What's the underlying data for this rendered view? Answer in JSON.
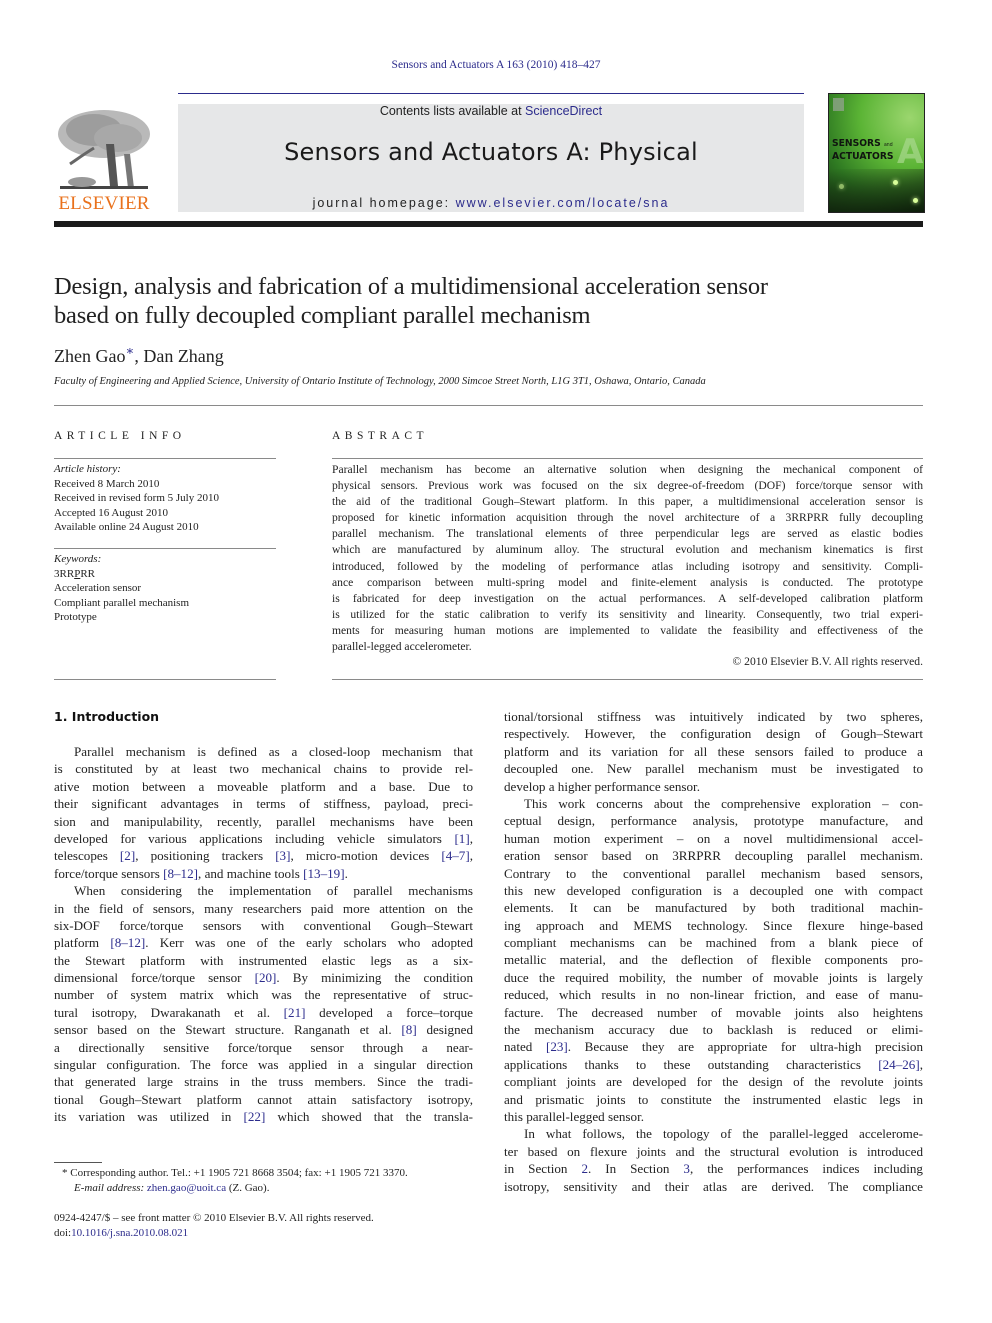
{
  "header": {
    "running_head": "Sensors and Actuators A 163 (2010) 418–427",
    "contents_prefix": "Contents lists available at ",
    "contents_link": "ScienceDirect",
    "journal_title": "Sensors and Actuators A: Physical",
    "homepage_prefix": "journal homepage: ",
    "homepage_link": "www.elsevier.com/locate/sna",
    "publisher_logo_text": "ELSEVIER",
    "cover": {
      "line1": "SENSORS",
      "and": "and",
      "line2": "ACTUATORS",
      "letter": "A"
    },
    "colors": {
      "link": "#2c2c8c",
      "publisher_orange": "#e9711c",
      "masthead_bg": "#e6e7e8",
      "cover_green": "#5bb435"
    }
  },
  "article": {
    "title_lines": [
      "Design, analysis and fabrication of a multidimensional acceleration sensor",
      "based on fully decoupled compliant parallel mechanism"
    ],
    "author1": "Zhen Gao",
    "author1_mark": "∗",
    "author_sep": ", ",
    "author2": "Dan Zhang",
    "affiliation": "Faculty of Engineering and Applied Science, University of Ontario Institute of Technology, 2000 Simcoe Street North, L1G 3T1, Oshawa, Ontario, Canada"
  },
  "article_info": {
    "heading": "ARTICLE INFO",
    "history_label": "Article history:",
    "history": [
      "Received 8 March 2010",
      "Received in revised form 5 July 2010",
      "Accepted 16 August 2010",
      "Available online 24 August 2010"
    ],
    "keywords_label": "Keywords:",
    "keyword1_a": "3RR",
    "keyword1_p": "P",
    "keyword1_b": "RR",
    "keywords": [
      "Acceleration sensor",
      "Compliant parallel mechanism",
      "Prototype"
    ]
  },
  "abstract": {
    "heading": "ABSTRACT",
    "lines": [
      "Parallel mechanism has become an alternative solution when designing the mechanical component of",
      "physical sensors. Previous work was focused on the six degree-of-freedom (DOF) force/torque sensor with",
      "the aid of the traditional Gough–Stewart platform. In this paper, a multidimensional acceleration sensor is",
      "proposed for kinetic information acquisition through the novel architecture of a 3RRPRR fully decoupling",
      "parallel mechanism. The translational elements of three perpendicular legs are served as elastic bodies",
      "which are manufactured by aluminum alloy. The structural evolution and mechanism kinematics is first",
      "introduced, followed by the modeling of performance atlas including isotropy and sensitivity. Compli-",
      "ance comparison between multi-spring model and finite-element analysis is conducted. The prototype",
      "is fabricated for deep investigation on the actual performances. A self-developed calibration platform",
      "is utilized for the static calibration to verify its sensitivity and linearity. Consequently, two trial experi-",
      "ments for measuring human motions are implemented to validate the feasibility and effectiveness of the",
      "parallel-legged accelerometer."
    ],
    "copyright": "© 2010 Elsevier B.V. All rights reserved."
  },
  "body": {
    "section_heading": "1.  Introduction",
    "left_column": [
      {
        "t": "Parallel mechanism is defined as a closed-loop mechanism that",
        "indent": true
      },
      {
        "t": "is constituted by at least two mechanical chains to provide rel-"
      },
      {
        "t": "ative motion between a moveable platform and a base. Due to"
      },
      {
        "t": "their significant advantages in terms of stiffness, payload, preci-"
      },
      {
        "t": "sion and manipulability, recently, parallel mechanisms have been"
      },
      {
        "t": "developed for various applications including vehicle simulators [1],"
      },
      {
        "t": "telescopes [2], positioning trackers [3], micro-motion devices [4–7],"
      },
      {
        "t": "force/torque sensors [8–12], and machine tools [13–19].",
        "last": true
      },
      {
        "t": "When considering the implementation of parallel mechanisms",
        "indent": true
      },
      {
        "t": "in the field of sensors, many researchers paid more attention on the"
      },
      {
        "t": "six-DOF force/torque sensors with conventional Gough–Stewart"
      },
      {
        "t": "platform [8–12]. Kerr was one of the early scholars who adopted"
      },
      {
        "t": "the Stewart platform with instrumented elastic legs as a six-"
      },
      {
        "t": "dimensional force/torque sensor [20]. By minimizing the condition"
      },
      {
        "t": "number of system matrix which was the representative of struc-"
      },
      {
        "t": "tural isotropy, Dwarakanath et al. [21] developed a force–torque"
      },
      {
        "t": "sensor based on the Stewart structure. Ranganath et al. [8] designed"
      },
      {
        "t": "a directionally sensitive force/torque sensor through a near-"
      },
      {
        "t": "singular configuration. The force was applied in a singular direction"
      },
      {
        "t": "that generated large strains in the truss members. Since the tradi-"
      },
      {
        "t": "tional Gough–Stewart platform cannot attain satisfactory isotropy,"
      },
      {
        "t": "its variation was utilized in [22] which showed that the transla-"
      }
    ],
    "right_column": [
      {
        "t": "tional/torsional stiffness was intuitively indicated by two spheres,"
      },
      {
        "t": "respectively. However, the configuration design of Gough–Stewart"
      },
      {
        "t": "platform and its variation for all these sensors failed to produce a"
      },
      {
        "t": "decoupled one. New parallel mechanism must be investigated to"
      },
      {
        "t": "develop a higher performance sensor.",
        "last": true
      },
      {
        "t": "This work concerns about the comprehensive exploration – con-",
        "indent": true
      },
      {
        "t": "ceptual design, performance analysis, prototype manufacture, and"
      },
      {
        "t": "human motion experiment – on a novel multidimensional accel-"
      },
      {
        "t": "eration sensor based on 3RRPRR decoupling parallel mechanism."
      },
      {
        "t": "Contrary to the conventional parallel mechanism based sensors,"
      },
      {
        "t": "this new developed configuration is a decoupled one with compact"
      },
      {
        "t": "elements. It can be manufactured by both traditional machin-"
      },
      {
        "t": "ing approach and MEMS technology. Since flexure hinge-based"
      },
      {
        "t": "compliant mechanisms can be machined from a blank piece of"
      },
      {
        "t": "metallic material, and the deflection of flexible components pro-"
      },
      {
        "t": "duce the required mobility, the number of movable joints is largely"
      },
      {
        "t": "reduced, which results in no non-linear friction, and ease of manu-"
      },
      {
        "t": "facture. The decreased number of movable joints also heightens"
      },
      {
        "t": "the mechanism accuracy due to backlash is reduced or elimi-"
      },
      {
        "t": "nated [23]. Because they are appropriate for ultra-high precision"
      },
      {
        "t": "applications thanks to these outstanding characteristics [24–26],"
      },
      {
        "t": "compliant joints are developed for the design of the revolute joints"
      },
      {
        "t": "and prismatic joints to constitute the instrumented elastic legs in"
      },
      {
        "t": "this parallel-legged sensor.",
        "last": true
      },
      {
        "t": "In what follows, the topology of the parallel-legged accelerome-",
        "indent": true
      },
      {
        "t": "ter based on flexure joints and the structural evolution is introduced"
      },
      {
        "t": "in Section 2. In Section 3, the performances indices including"
      },
      {
        "t": "isotropy, sensitivity and their atlas are derived. The compliance"
      }
    ]
  },
  "footnote": {
    "mark": "*",
    "corresponding": "Corresponding author. Tel.: +1 1905 721 8668 3504; fax: +1 1905 721 3370.",
    "email_label": "E-mail address: ",
    "email": "zhen.gao@uoit.ca",
    "email_suffix": " (Z. Gao).",
    "front_matter": "0924-4247/$ – see front matter © 2010 Elsevier B.V. All rights reserved.",
    "doi_prefix": "doi:",
    "doi": "10.1016/j.sna.2010.08.021"
  }
}
